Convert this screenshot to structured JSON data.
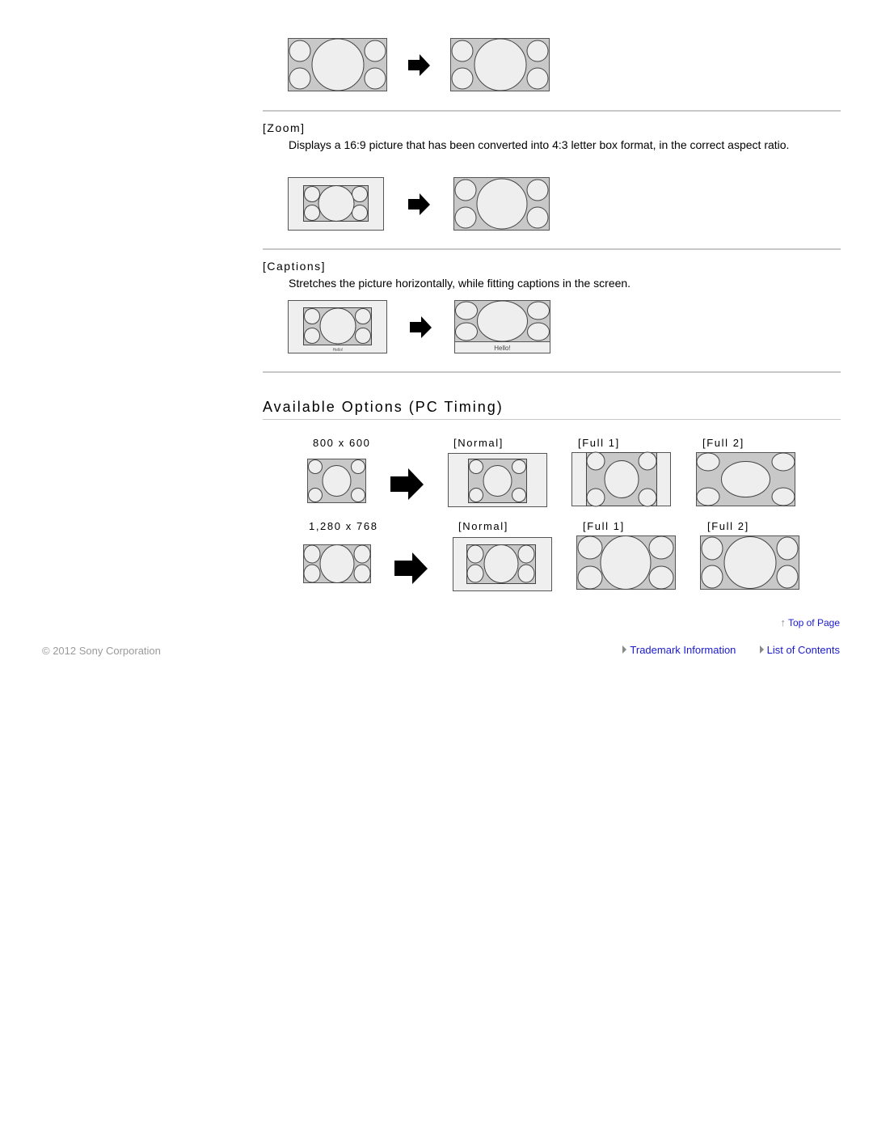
{
  "sections": [
    {
      "label": "",
      "description": "",
      "before": "wide-full",
      "after": "wide-full"
    },
    {
      "label": "[Zoom]",
      "description": "Displays a 16:9 picture that has been converted into 4:3 letter box format, in the correct aspect ratio.",
      "before": "letterbox",
      "after": "wide-full"
    },
    {
      "label": "[Captions]",
      "description": "Stretches the picture horizontally, while fitting captions in the screen.",
      "before": "letterbox-caption",
      "after": "stretched-caption",
      "caption_small": "Hello!",
      "caption_large": "Hello!"
    }
  ],
  "pc_timing": {
    "heading": "Available Options (PC Timing)",
    "rows": [
      {
        "resolution": "800 x 600",
        "options": [
          "[Normal]",
          "[Full 1]",
          "[Full 2]"
        ]
      },
      {
        "resolution": "1,280 x 768",
        "options": [
          "[Normal]",
          "[Full 1]",
          "[Full 2]"
        ]
      }
    ]
  },
  "footer": {
    "top_of_page": "Top of Page",
    "copyright": "© 2012 Sony Corporation",
    "links": [
      "Trademark Information",
      "List of Contents"
    ]
  },
  "colors": {
    "link": "#1a1acc",
    "frame_fill": "#c8c8c8",
    "circle_fill": "#eeeeee",
    "letterbox_fill": "#efefef",
    "rule": "#c8c8c8"
  }
}
